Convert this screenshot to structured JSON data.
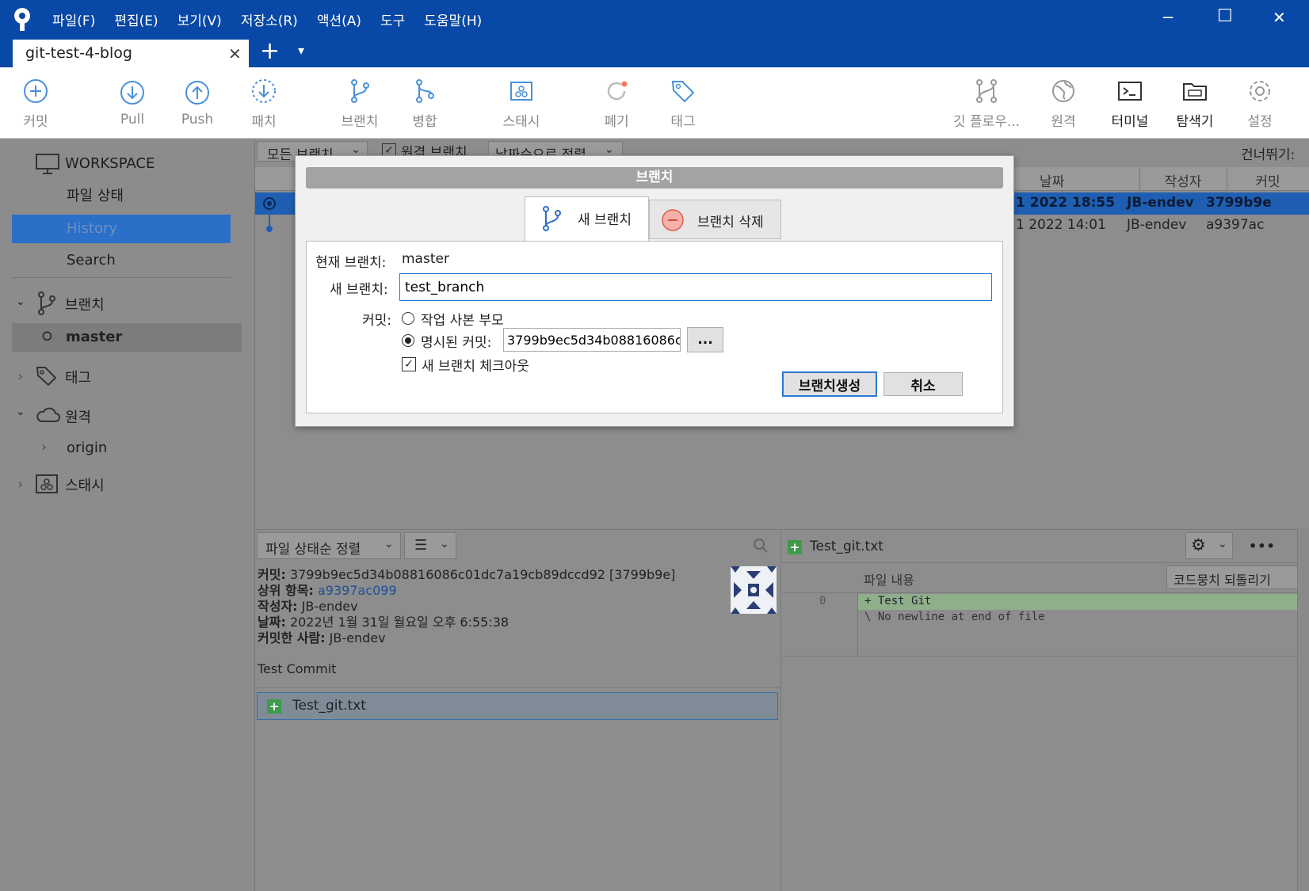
{
  "menu": [
    "파일(F)",
    "편집(E)",
    "보기(V)",
    "저장소(R)",
    "액션(A)",
    "도구",
    "도움말(H)"
  ],
  "window_controls": {
    "minimize": "─",
    "maximize": "☐",
    "close": "✕"
  },
  "tab": {
    "label": "git-test-4-blog",
    "close": "✕",
    "add": "+",
    "dropdown": "▾"
  },
  "toolbar": {
    "commit": "커밋",
    "pull": "Pull",
    "push": "Push",
    "patch": "패치",
    "branch": "브랜치",
    "merge": "병합",
    "stash": "스태시",
    "discard": "폐기",
    "tag": "태그",
    "gitflow": "깃 플로우...",
    "remote": "원격",
    "terminal": "터미널",
    "explorer": "탐색기",
    "settings": "설정"
  },
  "sidebar": {
    "workspace": "WORKSPACE",
    "file_status": "파일 상태",
    "history": "History",
    "search": "Search",
    "branches": "브랜치",
    "master": "master",
    "tags": "태그",
    "remotes": "원격",
    "origin": "origin",
    "stashes": "스태시"
  },
  "filter": {
    "all_branches": "모든 브랜치",
    "remote_branches": "원격 브랜치",
    "sort": "날짜순으로 정렬",
    "jump": "건너뛰기:"
  },
  "columns": {
    "date": "날짜",
    "author": "작성자",
    "commit": "커밋"
  },
  "commits": [
    {
      "date": "1 2022 18:55",
      "author": "JB-endev",
      "hash": "3799b9e"
    },
    {
      "date": "1 2022 14:01",
      "author": "JB-endev",
      "hash": "a9397ac"
    }
  ],
  "details": {
    "sort": "파일 상태순 정렬",
    "commit_label": "커밋:",
    "commit_value": "3799b9ec5d34b08816086c01dc7a19cb89dccd92 [3799b9e]",
    "parent_label": "상위 항목:",
    "parent_value": "a9397ac099",
    "author_label": "작성자:",
    "author_value": "JB-endev",
    "date_label": "날짜:",
    "date_value": "2022년 1월 31일 월요일 오후 6:55:38",
    "committer_label": "커밋한 사람:",
    "committer_value": "JB-endev",
    "message": "Test Commit",
    "file": "Test_git.txt"
  },
  "diff": {
    "file": "Test_git.txt",
    "content_label": "파일 내용",
    "revert": "코드뭉치 되돌리기",
    "line_no": "0",
    "line1": "+ Test Git",
    "line2": "\\  No newline at end of file",
    "more": "•••"
  },
  "dialog": {
    "title": "브랜치",
    "tab_new": "새 브랜치",
    "tab_delete": "브랜치 삭제",
    "current_label": "현재 브랜치:",
    "current_value": "master",
    "new_label": "새 브랜치:",
    "new_value": "test_branch",
    "commit_label": "커밋:",
    "option_working": "작업 사본 부모",
    "option_specified": "명시된 커밋:",
    "specified_value": "3799b9ec5d34b08816086c",
    "browse": "...",
    "checkout": "새 브랜치 체크아웃",
    "create": "브랜치생성",
    "cancel": "취소"
  },
  "colors": {
    "titlebar": "#0848a6",
    "accent": "#1f6fd1",
    "selected": "#2a6fc8"
  }
}
